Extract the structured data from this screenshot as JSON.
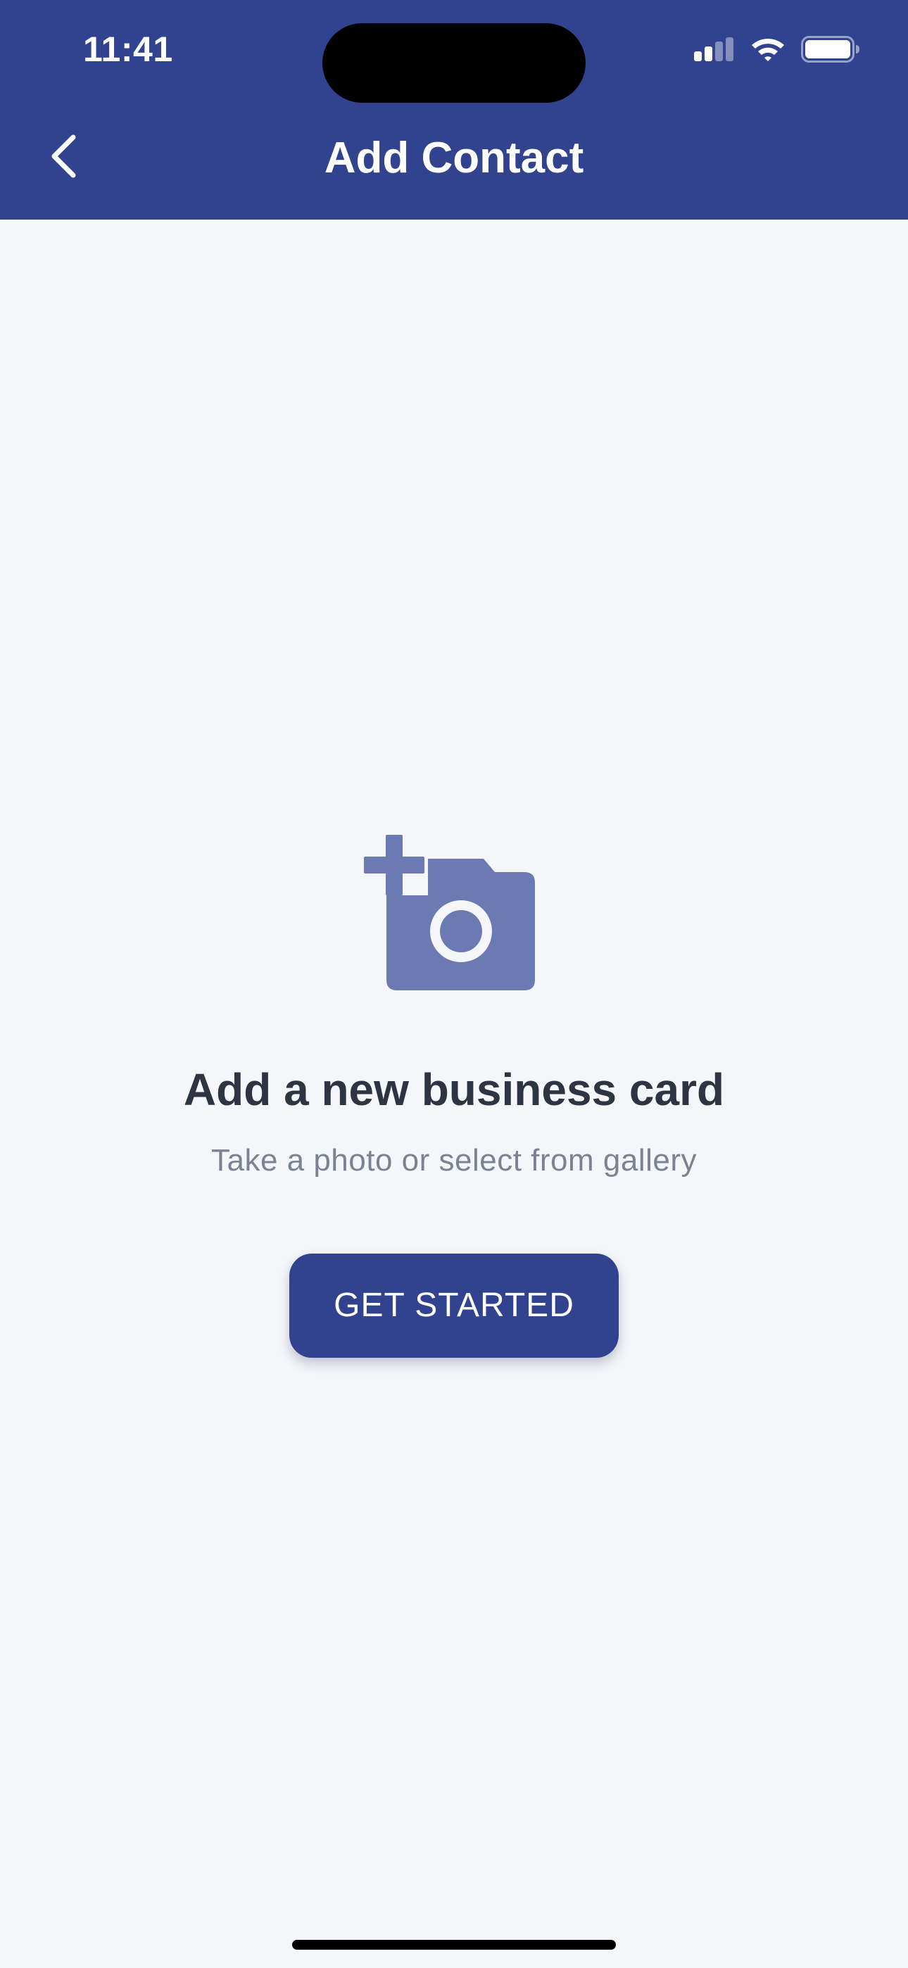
{
  "status_bar": {
    "time": "11:41",
    "icons": [
      "cellular-signal-icon",
      "wifi-icon",
      "battery-icon"
    ]
  },
  "header": {
    "title": "Add Contact",
    "back_icon": "chevron-left-icon"
  },
  "empty_state": {
    "icon": "add-a-photo-icon",
    "title": "Add a new business card",
    "subtitle": "Take a photo or select from gallery",
    "button_label": "GET STARTED"
  },
  "colors": {
    "primary": "#31438f",
    "icon": "#6b7ab2",
    "background": "#f5f6fa",
    "title_text": "#2f3443",
    "subtitle_text": "#7b8292"
  }
}
